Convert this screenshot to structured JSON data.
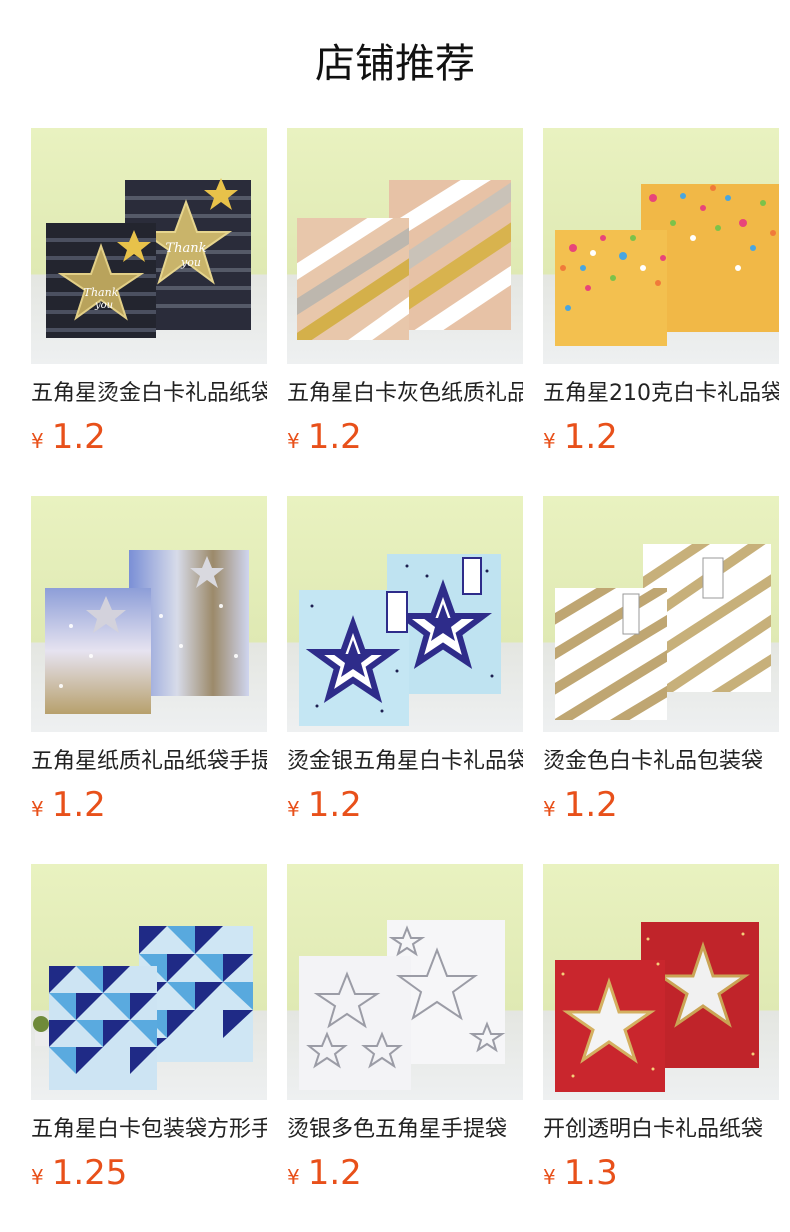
{
  "page": {
    "title": "店铺推荐"
  },
  "colors": {
    "price": "#e8501a",
    "title": "#111111"
  },
  "products": [
    {
      "name": "五角星烫金白卡礼品纸袋",
      "currency": "¥",
      "price": "1.2",
      "image": "black-gold-thank-you-star-bags"
    },
    {
      "name": "五角星白卡灰色纸质礼品袋",
      "currency": "¥",
      "price": "1.2",
      "image": "glitter-stripe-bags"
    },
    {
      "name": "五角星210克白卡礼品袋",
      "currency": "¥",
      "price": "1.2",
      "image": "yellow-confetti-star-bags"
    },
    {
      "name": "五角星纸质礼品纸袋手提袋",
      "currency": "¥",
      "price": "1.2",
      "image": "holographic-star-bags"
    },
    {
      "name": "烫金银五角星白卡礼品袋",
      "currency": "¥",
      "price": "1.2",
      "image": "blue-navy-star-bags"
    },
    {
      "name": "烫金色白卡礼品包装袋",
      "currency": "¥",
      "price": "1.2",
      "image": "gold-stripe-bags"
    },
    {
      "name": "五角星白卡包装袋方形手提袋",
      "currency": "¥",
      "price": "1.25",
      "image": "blue-triangle-bags"
    },
    {
      "name": "烫银多色五角星手提袋",
      "currency": "¥",
      "price": "1.2",
      "image": "silver-star-bags"
    },
    {
      "name": "开创透明白卡礼品纸袋",
      "currency": "¥",
      "price": "1.3",
      "image": "red-window-star-bags"
    }
  ]
}
